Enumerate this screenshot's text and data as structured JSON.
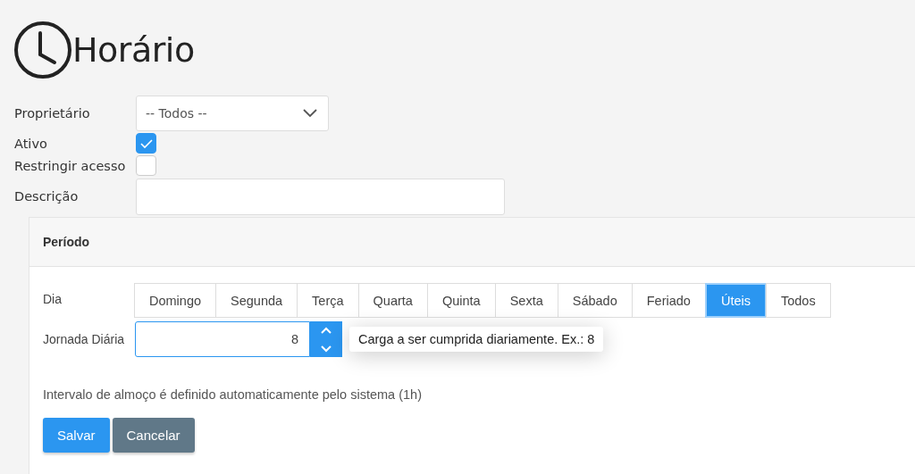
{
  "title": "Horário",
  "form": {
    "owner": {
      "label": "Proprietário",
      "value": "-- Todos --"
    },
    "active": {
      "label": "Ativo",
      "checked": true
    },
    "restrict": {
      "label": "Restringir acesso",
      "checked": false
    },
    "description": {
      "label": "Descrição"
    }
  },
  "panel": {
    "title": "Período",
    "day_label": "Dia",
    "days": [
      {
        "label": "Domingo",
        "selected": false
      },
      {
        "label": "Segunda",
        "selected": false
      },
      {
        "label": "Terça",
        "selected": false
      },
      {
        "label": "Quarta",
        "selected": false
      },
      {
        "label": "Quinta",
        "selected": false
      },
      {
        "label": "Sexta",
        "selected": false
      },
      {
        "label": "Sábado",
        "selected": false
      },
      {
        "label": "Feriado",
        "selected": false
      },
      {
        "label": "Úteis",
        "selected": true
      },
      {
        "label": "Todos",
        "selected": false
      }
    ],
    "hours": {
      "label": "Jornada Diária",
      "value": "8",
      "tooltip": "Carga a ser cumprida diariamente. Ex.: 8"
    },
    "note": "Intervalo de almoço é definido automaticamente pelo sistema (1h)",
    "buttons": [
      {
        "label": "Salvar",
        "kind": "primary"
      },
      {
        "label": "Cancelar",
        "kind": "secondary"
      }
    ]
  }
}
